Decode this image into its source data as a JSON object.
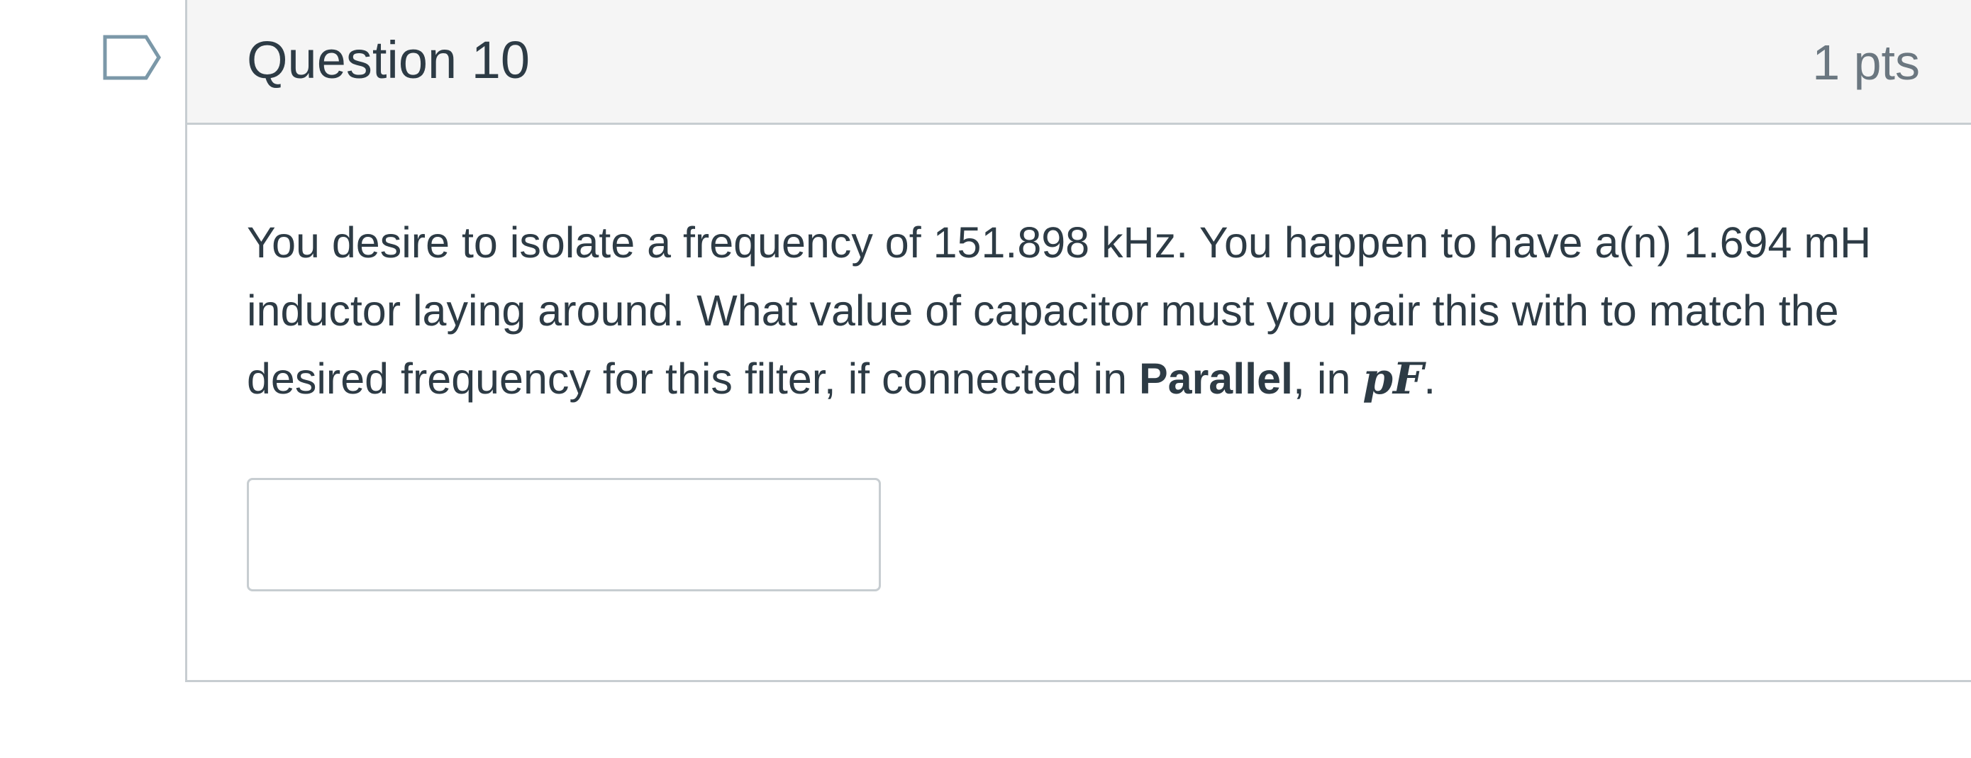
{
  "question": {
    "title": "Question 10",
    "points": "1 pts",
    "flag_icon": "bookmark-flag-icon",
    "text": {
      "line1": "You desire to isolate a frequency of 151.898 kHz. You happen to have a(n) 1.694 mH",
      "line2": "inductor laying around. What value of capacitor must you pair this with to match the",
      "line3_prefix": "desired frequency for this filter, if connected in ",
      "line3_bold": "Parallel",
      "line3_middle": ", in ",
      "line3_math": "pF",
      "line3_suffix": "."
    },
    "answer": {
      "value": "",
      "placeholder": ""
    }
  },
  "colors": {
    "header_bg": "#f5f5f5",
    "border": "#c7cdd1",
    "text": "#2d3b45",
    "muted_text": "#6b7780",
    "flag_stroke": "#7b98a8"
  }
}
